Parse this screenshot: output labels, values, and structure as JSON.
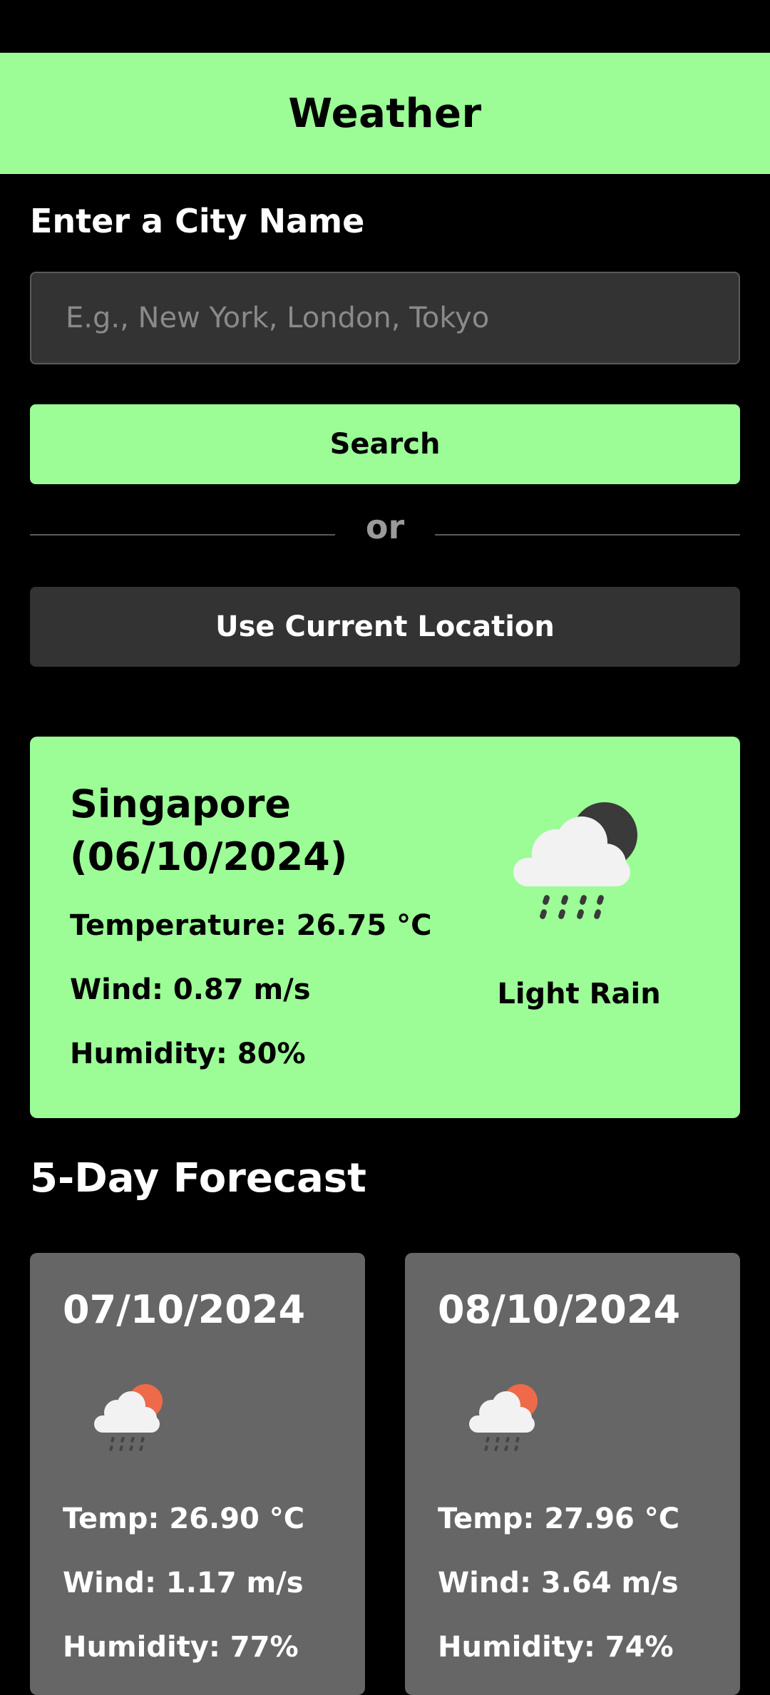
{
  "header": {
    "title": "Weather"
  },
  "search": {
    "label": "Enter a City Name",
    "placeholder": "E.g., New York, London, Tokyo",
    "value": "",
    "search_button": "Search",
    "divider_text": "or",
    "location_button": "Use Current Location"
  },
  "current": {
    "city_line1": "Singapore",
    "city_line2": "(06/10/2024)",
    "temperature": "Temperature: 26.75 °C",
    "wind": "Wind: 0.87 m/s",
    "humidity": "Humidity: 80%",
    "description": "Light Rain",
    "icon": "rain-cloud-moon-icon"
  },
  "forecast": {
    "title": "5-Day Forecast",
    "days": [
      {
        "date": "07/10/2024",
        "temp": "Temp: 26.90 °C",
        "wind": "Wind: 1.17 m/s",
        "humidity": "Humidity: 77%",
        "icon": "rain-cloud-sun-icon"
      },
      {
        "date": "08/10/2024",
        "temp": "Temp: 27.96 °C",
        "wind": "Wind: 3.64 m/s",
        "humidity": "Humidity: 74%",
        "icon": "rain-cloud-sun-icon"
      }
    ]
  },
  "colors": {
    "accent": "#9cfd97",
    "background": "#000000",
    "input_bg": "#333333",
    "card_bg": "#666666",
    "sun": "#ee6a4a",
    "moon": "#3a3a3a",
    "cloud": "#f2f2f2"
  }
}
